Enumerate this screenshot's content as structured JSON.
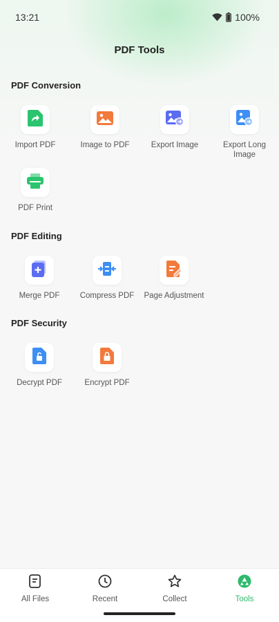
{
  "status_bar": {
    "time": "13:21",
    "battery": "100%"
  },
  "header": {
    "title": "PDF Tools"
  },
  "sections": [
    {
      "title": "PDF Conversion",
      "tools": [
        {
          "label": "Import PDF",
          "icon": "import-pdf-icon",
          "color": "#2ac46e"
        },
        {
          "label": "Image to PDF",
          "icon": "image-to-pdf-icon",
          "color": "#f27a3c"
        },
        {
          "label": "Export Image",
          "icon": "export-image-icon",
          "color": "#5b6cf2"
        },
        {
          "label": "Export Long Image",
          "icon": "export-long-image-icon",
          "color": "#3d8ef5"
        },
        {
          "label": "PDF Print",
          "icon": "pdf-print-icon",
          "color": "#2ac46e"
        }
      ]
    },
    {
      "title": "PDF Editing",
      "tools": [
        {
          "label": "Merge PDF",
          "icon": "merge-pdf-icon",
          "color": "#5b6cf2"
        },
        {
          "label": "Compress PDF",
          "icon": "compress-pdf-icon",
          "color": "#3d8ef5"
        },
        {
          "label": "Page Adjustment",
          "icon": "page-adjustment-icon",
          "color": "#f27a3c"
        }
      ]
    },
    {
      "title": "PDF Security",
      "tools": [
        {
          "label": "Decrypt PDF",
          "icon": "decrypt-pdf-icon",
          "color": "#3d8ef5"
        },
        {
          "label": "Encrypt PDF",
          "icon": "encrypt-pdf-icon",
          "color": "#f27a3c"
        }
      ]
    }
  ],
  "bottom_nav": [
    {
      "label": "All Files",
      "icon": "all-files-icon",
      "active": false
    },
    {
      "label": "Recent",
      "icon": "recent-clock-icon",
      "active": false
    },
    {
      "label": "Collect",
      "icon": "collect-star-icon",
      "active": false
    },
    {
      "label": "Tools",
      "icon": "tools-icon",
      "active": true
    }
  ],
  "colors": {
    "accent": "#2dbb6b",
    "background": "#f7f7f7"
  }
}
